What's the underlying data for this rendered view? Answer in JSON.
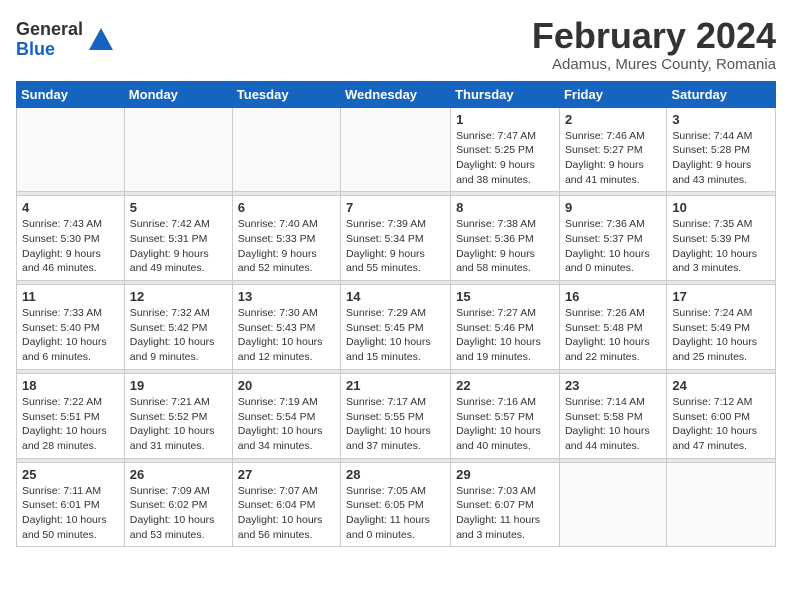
{
  "logo": {
    "line1": "General",
    "line2": "Blue"
  },
  "title": "February 2024",
  "subtitle": "Adamus, Mures County, Romania",
  "weekdays": [
    "Sunday",
    "Monday",
    "Tuesday",
    "Wednesday",
    "Thursday",
    "Friday",
    "Saturday"
  ],
  "weeks": [
    [
      {
        "day": "",
        "info": ""
      },
      {
        "day": "",
        "info": ""
      },
      {
        "day": "",
        "info": ""
      },
      {
        "day": "",
        "info": ""
      },
      {
        "day": "1",
        "info": "Sunrise: 7:47 AM\nSunset: 5:25 PM\nDaylight: 9 hours\nand 38 minutes."
      },
      {
        "day": "2",
        "info": "Sunrise: 7:46 AM\nSunset: 5:27 PM\nDaylight: 9 hours\nand 41 minutes."
      },
      {
        "day": "3",
        "info": "Sunrise: 7:44 AM\nSunset: 5:28 PM\nDaylight: 9 hours\nand 43 minutes."
      }
    ],
    [
      {
        "day": "4",
        "info": "Sunrise: 7:43 AM\nSunset: 5:30 PM\nDaylight: 9 hours\nand 46 minutes."
      },
      {
        "day": "5",
        "info": "Sunrise: 7:42 AM\nSunset: 5:31 PM\nDaylight: 9 hours\nand 49 minutes."
      },
      {
        "day": "6",
        "info": "Sunrise: 7:40 AM\nSunset: 5:33 PM\nDaylight: 9 hours\nand 52 minutes."
      },
      {
        "day": "7",
        "info": "Sunrise: 7:39 AM\nSunset: 5:34 PM\nDaylight: 9 hours\nand 55 minutes."
      },
      {
        "day": "8",
        "info": "Sunrise: 7:38 AM\nSunset: 5:36 PM\nDaylight: 9 hours\nand 58 minutes."
      },
      {
        "day": "9",
        "info": "Sunrise: 7:36 AM\nSunset: 5:37 PM\nDaylight: 10 hours\nand 0 minutes."
      },
      {
        "day": "10",
        "info": "Sunrise: 7:35 AM\nSunset: 5:39 PM\nDaylight: 10 hours\nand 3 minutes."
      }
    ],
    [
      {
        "day": "11",
        "info": "Sunrise: 7:33 AM\nSunset: 5:40 PM\nDaylight: 10 hours\nand 6 minutes."
      },
      {
        "day": "12",
        "info": "Sunrise: 7:32 AM\nSunset: 5:42 PM\nDaylight: 10 hours\nand 9 minutes."
      },
      {
        "day": "13",
        "info": "Sunrise: 7:30 AM\nSunset: 5:43 PM\nDaylight: 10 hours\nand 12 minutes."
      },
      {
        "day": "14",
        "info": "Sunrise: 7:29 AM\nSunset: 5:45 PM\nDaylight: 10 hours\nand 15 minutes."
      },
      {
        "day": "15",
        "info": "Sunrise: 7:27 AM\nSunset: 5:46 PM\nDaylight: 10 hours\nand 19 minutes."
      },
      {
        "day": "16",
        "info": "Sunrise: 7:26 AM\nSunset: 5:48 PM\nDaylight: 10 hours\nand 22 minutes."
      },
      {
        "day": "17",
        "info": "Sunrise: 7:24 AM\nSunset: 5:49 PM\nDaylight: 10 hours\nand 25 minutes."
      }
    ],
    [
      {
        "day": "18",
        "info": "Sunrise: 7:22 AM\nSunset: 5:51 PM\nDaylight: 10 hours\nand 28 minutes."
      },
      {
        "day": "19",
        "info": "Sunrise: 7:21 AM\nSunset: 5:52 PM\nDaylight: 10 hours\nand 31 minutes."
      },
      {
        "day": "20",
        "info": "Sunrise: 7:19 AM\nSunset: 5:54 PM\nDaylight: 10 hours\nand 34 minutes."
      },
      {
        "day": "21",
        "info": "Sunrise: 7:17 AM\nSunset: 5:55 PM\nDaylight: 10 hours\nand 37 minutes."
      },
      {
        "day": "22",
        "info": "Sunrise: 7:16 AM\nSunset: 5:57 PM\nDaylight: 10 hours\nand 40 minutes."
      },
      {
        "day": "23",
        "info": "Sunrise: 7:14 AM\nSunset: 5:58 PM\nDaylight: 10 hours\nand 44 minutes."
      },
      {
        "day": "24",
        "info": "Sunrise: 7:12 AM\nSunset: 6:00 PM\nDaylight: 10 hours\nand 47 minutes."
      }
    ],
    [
      {
        "day": "25",
        "info": "Sunrise: 7:11 AM\nSunset: 6:01 PM\nDaylight: 10 hours\nand 50 minutes."
      },
      {
        "day": "26",
        "info": "Sunrise: 7:09 AM\nSunset: 6:02 PM\nDaylight: 10 hours\nand 53 minutes."
      },
      {
        "day": "27",
        "info": "Sunrise: 7:07 AM\nSunset: 6:04 PM\nDaylight: 10 hours\nand 56 minutes."
      },
      {
        "day": "28",
        "info": "Sunrise: 7:05 AM\nSunset: 6:05 PM\nDaylight: 11 hours\nand 0 minutes."
      },
      {
        "day": "29",
        "info": "Sunrise: 7:03 AM\nSunset: 6:07 PM\nDaylight: 11 hours\nand 3 minutes."
      },
      {
        "day": "",
        "info": ""
      },
      {
        "day": "",
        "info": ""
      }
    ]
  ]
}
